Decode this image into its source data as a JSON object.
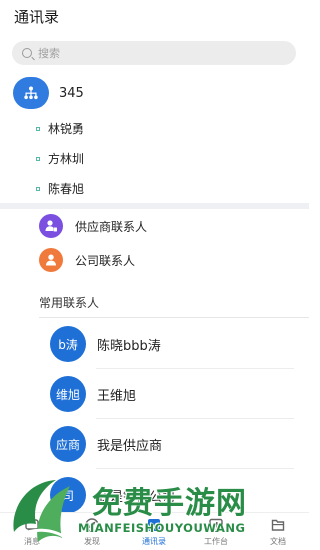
{
  "header": {
    "title": "通讯录"
  },
  "search": {
    "placeholder": "搜索"
  },
  "org": {
    "label": "345",
    "members": [
      "林锐勇",
      "方林圳",
      "陈春旭"
    ]
  },
  "groups": [
    {
      "label": "供应商联系人",
      "color": "#7b4fe0",
      "icon": "supplier-contact-icon"
    },
    {
      "label": "公司联系人",
      "color": "#f07a3c",
      "icon": "company-contact-icon"
    }
  ],
  "favorites": {
    "section_label": "常用联系人",
    "items": [
      {
        "avatar": "b涛",
        "name": "陈晓bbb涛"
      },
      {
        "avatar": "维旭",
        "name": "王维旭"
      },
      {
        "avatar": "应商",
        "name": "我是供应商"
      },
      {
        "avatar": "司",
        "name": "我是销售公司"
      }
    ]
  },
  "tabs": [
    {
      "label": "消息",
      "icon": "message-icon"
    },
    {
      "label": "发现",
      "icon": "compass-icon"
    },
    {
      "label": "通讯录",
      "icon": "contacts-icon",
      "active": true
    },
    {
      "label": "工作台",
      "icon": "workbench-icon"
    },
    {
      "label": "文档",
      "icon": "document-icon"
    }
  ],
  "watermark": {
    "title": "免费手游网",
    "subtitle": "MIANFEISHOUYOUWANG"
  },
  "colors": {
    "accent": "#1e6fd6",
    "org": "#2f7be0",
    "watermark": "#2a8d47"
  }
}
